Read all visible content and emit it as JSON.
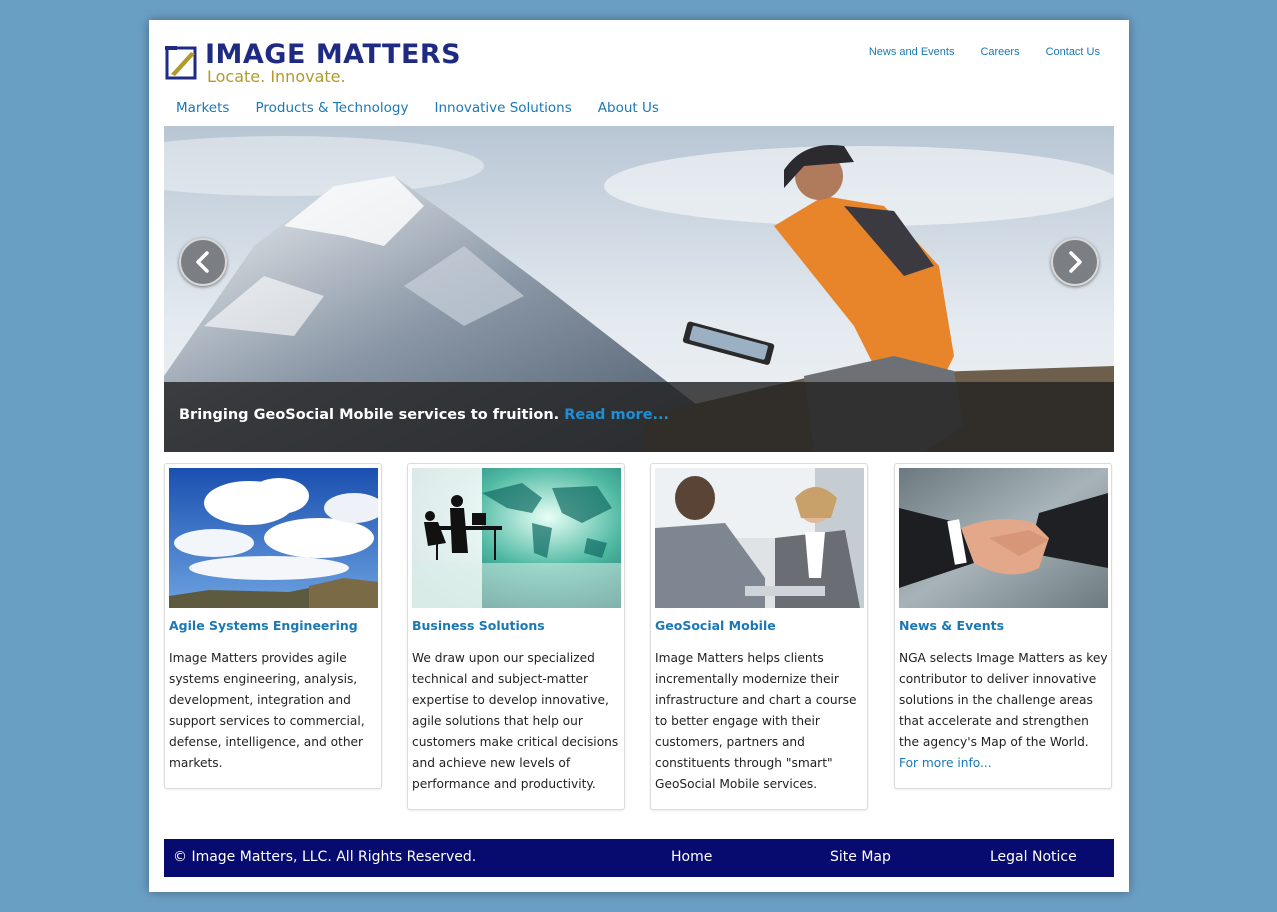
{
  "logo": {
    "title": "IMAGE MATTERS",
    "tagline": "Locate.  Innovate.",
    "colors": {
      "title": "#1f2a83",
      "tagline": "#b19a2c"
    }
  },
  "utility_nav": [
    "News and Events",
    "Careers",
    "Contact Us"
  ],
  "main_nav": [
    "Markets",
    "Products & Technology",
    "Innovative Solutions",
    "About Us"
  ],
  "hero": {
    "caption": "Bringing GeoSocial Mobile services to fruition.",
    "link": "Read more...",
    "prev_icon": "chevron-left-icon",
    "next_icon": "chevron-right-icon"
  },
  "cards": [
    {
      "title": "Agile Systems Engineering",
      "image": "sky-clouds-photo",
      "body": "Image Matters provides agile systems engineering, analysis, development, integration and support services to commercial, defense, intelligence, and other markets."
    },
    {
      "title": "Business Solutions",
      "image": "world-map-silhouette-photo",
      "body": "We draw upon our specialized technical and subject-matter expertise to develop innovative, agile solutions that help our customers make critical decisions and achieve new levels of performance and productivity."
    },
    {
      "title": "GeoSocial Mobile",
      "image": "business-meeting-photo",
      "body": "Image Matters helps clients incrementally modernize their infrastructure and chart a course to better engage with their customers, partners and constituents through \"smart\" GeoSocial Mobile services."
    },
    {
      "title": "News & Events",
      "image": "handshake-photo",
      "body": "NGA selects Image Matters as key contributor to deliver innovative solutions in the challenge areas that accelerate and strengthen the agency's Map of the World.",
      "link": "For more info..."
    }
  ],
  "footer": {
    "copyright": "© Image Matters, LLC. All Rights Reserved.",
    "links": [
      "Home",
      "Site Map",
      "Legal Notice"
    ]
  },
  "colors": {
    "background": "#6a9fc4",
    "link": "#1a78b4",
    "footer": "#070a6e"
  }
}
